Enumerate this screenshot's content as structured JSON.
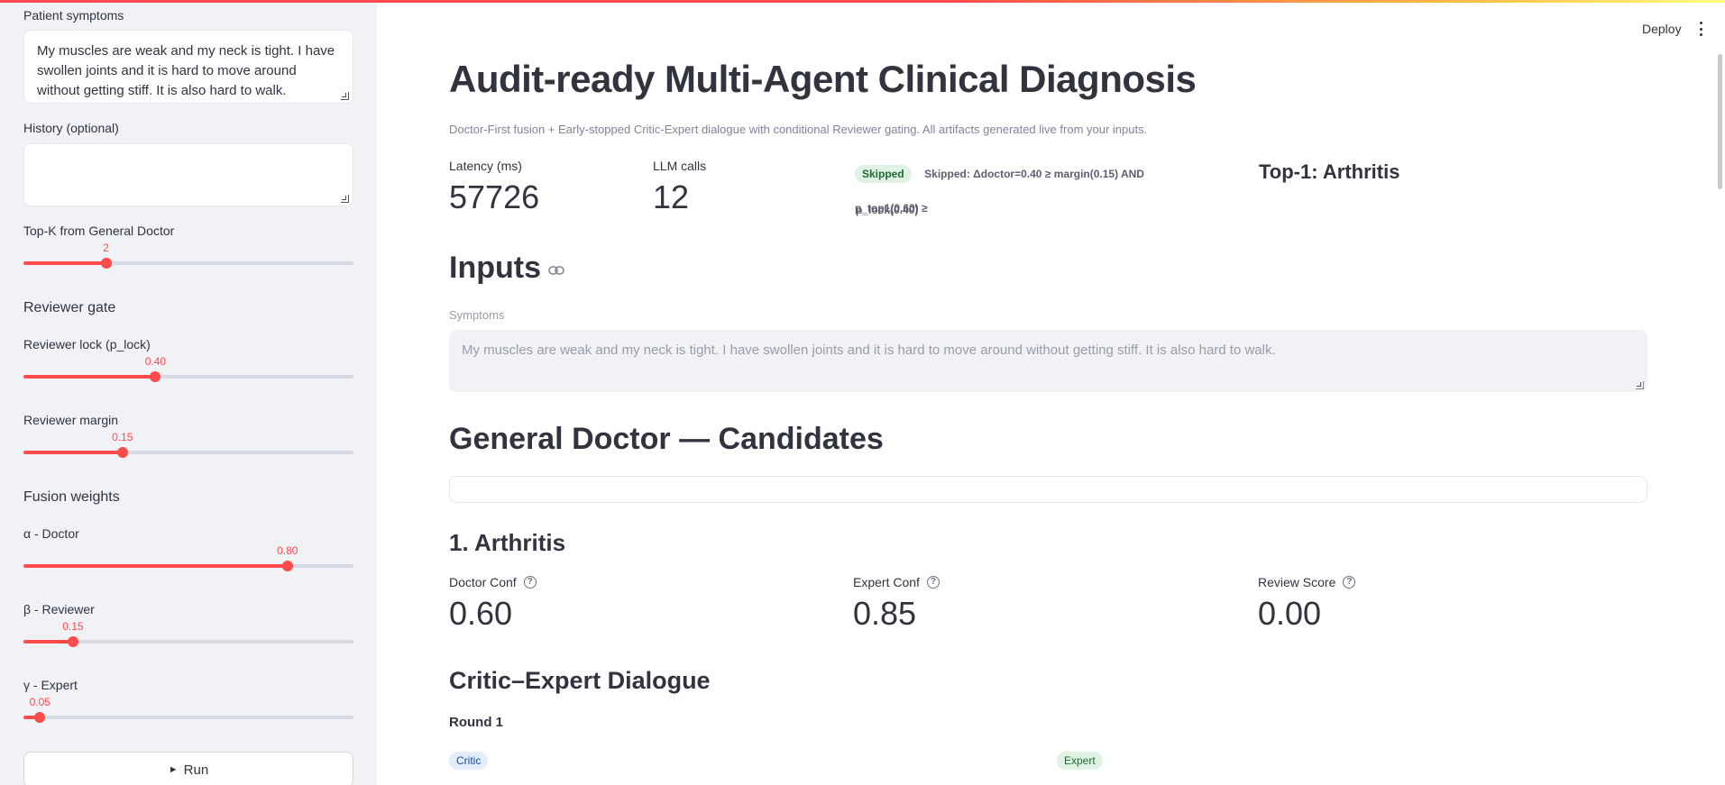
{
  "sidebar": {
    "symptoms_label": "Patient symptoms",
    "symptoms_value": "My muscles are weak and my neck is tight. I have swollen joints and it is hard to move around without getting stiff. It is also hard to walk.",
    "history_label": "History (optional)",
    "history_value": "",
    "topk_label": "Top-K from General Doctor",
    "topk": {
      "value": "2",
      "fraction": 0.25
    },
    "reviewer_gate_heading": "Reviewer gate",
    "plock_label": "Reviewer lock (p_lock)",
    "plock": {
      "value": "0.40",
      "fraction": 0.4
    },
    "margin_label": "Reviewer margin",
    "margin": {
      "value": "0.15",
      "fraction": 0.3
    },
    "fusion_heading": "Fusion weights",
    "alpha_label": "α - Doctor",
    "alpha": {
      "value": "0.80",
      "fraction": 0.8
    },
    "beta_label": "β - Reviewer",
    "beta": {
      "value": "0.15",
      "fraction": 0.15
    },
    "gamma_label": "γ - Expert",
    "gamma": {
      "value": "0.05",
      "fraction": 0.05
    },
    "run_label": "Run",
    "run_icon": "play-icon"
  },
  "toolbar": {
    "deploy_label": "Deploy",
    "menu_icon": "kebab-menu-icon"
  },
  "main": {
    "title": "Audit-ready Multi-Agent Clinical Diagnosis",
    "subtitle": "Doctor-First fusion + Early-stopped Critic-Expert dialogue with conditional Reviewer gating. All artifacts generated live from your inputs.",
    "latency_label": "Latency (ms)",
    "latency_value": "57726",
    "llm_label": "LLM calls",
    "llm_value": "12",
    "skipped_badge": "Skipped",
    "skipped_text_1": "Skipped: Δdoctor=0.40 ≥ margin(0.15) AND p_top1(0.60) ≥",
    "skipped_text_2": "p_lock(0.40)",
    "top1": "Top-1: Arthritis",
    "inputs_heading": "Inputs",
    "symptoms_caption": "Symptoms",
    "symptoms_echo": "My muscles are weak and my neck is tight. I have swollen joints and it is hard to move around without getting stiff. It is also hard to walk.",
    "candidates_heading": "General Doctor — Candidates",
    "candidate_title": "1. Arthritis",
    "doctor_conf_label": "Doctor Conf",
    "doctor_conf_value": "0.60",
    "expert_conf_label": "Expert Conf",
    "expert_conf_value": "0.85",
    "review_label": "Review Score",
    "review_value": "0.00",
    "dialogue_heading": "Critic–Expert Dialogue",
    "round_label": "Round 1",
    "critic_badge": "Critic",
    "expert_badge": "Expert"
  },
  "colors": {
    "accent": "#ff4b4b",
    "sidebar_bg": "#f0f2f6",
    "text": "#31333f",
    "muted": "#808495"
  }
}
